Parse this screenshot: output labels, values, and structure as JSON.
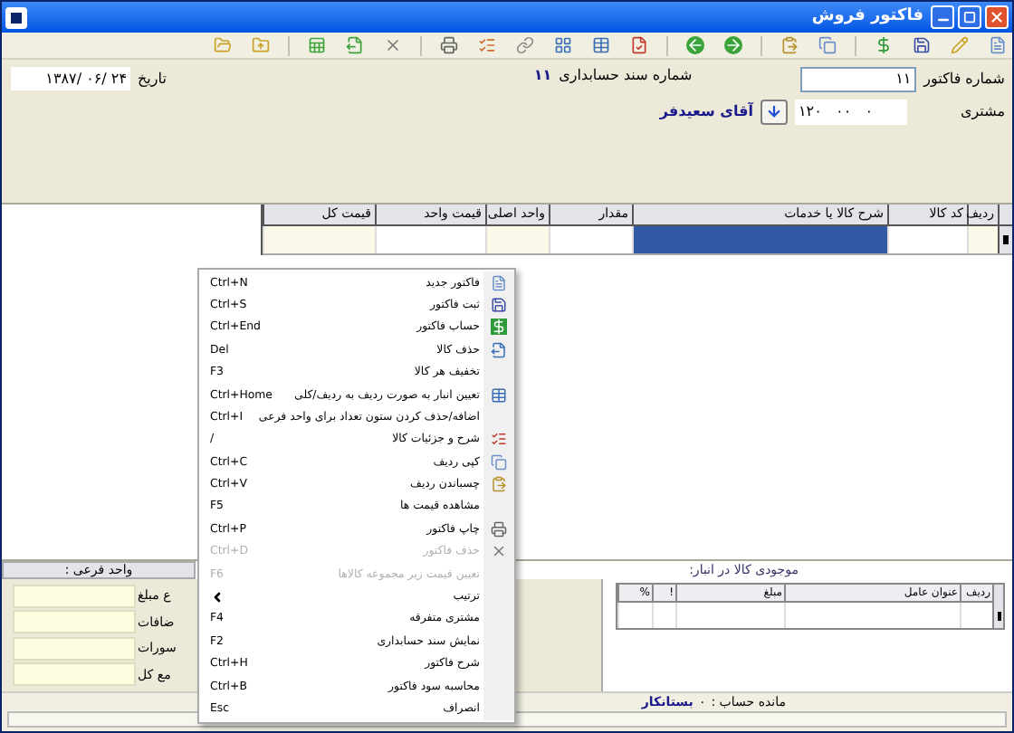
{
  "window": {
    "title": "فاکتور فروش"
  },
  "header": {
    "invoice_number_label": "شماره فاکتور",
    "invoice_number": "۱۱",
    "customer_label": "مشتری",
    "customer_code": "۱۲۰   ۰۰   ۰",
    "customer_name": "آقای سعیدفر",
    "doc_number_label": "شماره سند حسابداری",
    "doc_number": "۱۱",
    "date_label": "تاریخ",
    "date": "۱۳۸۷/ ۰۶/ ۲۴"
  },
  "table": {
    "columns": [
      "ردیف",
      "کد کالا",
      "شرح کالا یا خدمات",
      "مقدار",
      "واحد اصلی",
      "قیمت واحد",
      "قیمت کل"
    ],
    "row_cells": [
      {
        "selected": false
      },
      {
        "selected": false
      },
      {
        "selected": true
      },
      {
        "selected": false
      },
      {
        "selected": false
      },
      {
        "selected": false
      },
      {
        "selected": false
      }
    ]
  },
  "totals_panel": {
    "title": "واحد فرعی :",
    "fields": [
      {
        "label": "ع مبلغ"
      },
      {
        "label": "ضافات"
      },
      {
        "label": "سورات"
      },
      {
        "label": "مع کل"
      }
    ]
  },
  "stock_panel": {
    "title": "موجودی کالا در انبار:",
    "columns": [
      "ردیف",
      "عنوان عامل",
      "مبلغ",
      "!",
      "%"
    ]
  },
  "status_bar": {
    "balance_label": "مانده حساب :",
    "balance_value": "۰",
    "balance_status": "بستانکار"
  },
  "context_menu": [
    {
      "kind": "command",
      "label": "فاکتور جدید",
      "shortcut": "Ctrl+N",
      "disabled": false
    },
    {
      "kind": "command",
      "label": "ثبت فاکتور",
      "shortcut": "Ctrl+S",
      "disabled": false
    },
    {
      "kind": "command",
      "label": "حساب فاکتور",
      "shortcut": "Ctrl+End",
      "disabled": false
    },
    {
      "kind": "command",
      "label": "حذف کالا",
      "shortcut": "Del",
      "disabled": false
    },
    {
      "kind": "command",
      "label": "تخفیف هر کالا",
      "shortcut": "F3",
      "disabled": false
    },
    {
      "kind": "command",
      "label": "تعیین انبار به صورت ردیف به ردیف/کلی",
      "shortcut": "Ctrl+Home",
      "disabled": false
    },
    {
      "kind": "command",
      "label": "اضافه/حذف کردن ستون تعداد برای واحد فرعی",
      "shortcut": "Ctrl+I",
      "disabled": false
    },
    {
      "kind": "command",
      "label": "شرح و جزئیات کالا",
      "shortcut": "/",
      "disabled": false
    },
    {
      "kind": "command",
      "label": "کپی ردیف",
      "shortcut": "Ctrl+C",
      "disabled": false
    },
    {
      "kind": "command",
      "label": "چسباندن ردیف",
      "shortcut": "Ctrl+V",
      "disabled": false
    },
    {
      "kind": "command",
      "label": "مشاهده قیمت ها",
      "shortcut": "F5",
      "disabled": false
    },
    {
      "kind": "command",
      "label": "چاپ فاکتور",
      "shortcut": "Ctrl+P",
      "disabled": false
    },
    {
      "kind": "command",
      "label": "حذف فاکتور",
      "shortcut": "Ctrl+D",
      "disabled": true
    },
    {
      "kind": "command",
      "label": "تعیین قیمت زیر مجموعه کالاها",
      "shortcut": "F6",
      "disabled": true
    },
    {
      "kind": "submenu",
      "label": "ترتیب",
      "disabled": false
    },
    {
      "kind": "command",
      "label": "مشتری متفرقه",
      "shortcut": "F4",
      "disabled": false
    },
    {
      "kind": "command",
      "label": "نمایش سند حسابداری",
      "shortcut": "F2",
      "disabled": false
    },
    {
      "kind": "command",
      "label": "شرح فاکتور",
      "shortcut": "Ctrl+H",
      "disabled": false
    },
    {
      "kind": "command",
      "label": "محاسبه سود فاکتور",
      "shortcut": "Ctrl+B",
      "disabled": false
    },
    {
      "kind": "command",
      "label": "انصراف",
      "shortcut": "Esc",
      "disabled": false
    }
  ]
}
